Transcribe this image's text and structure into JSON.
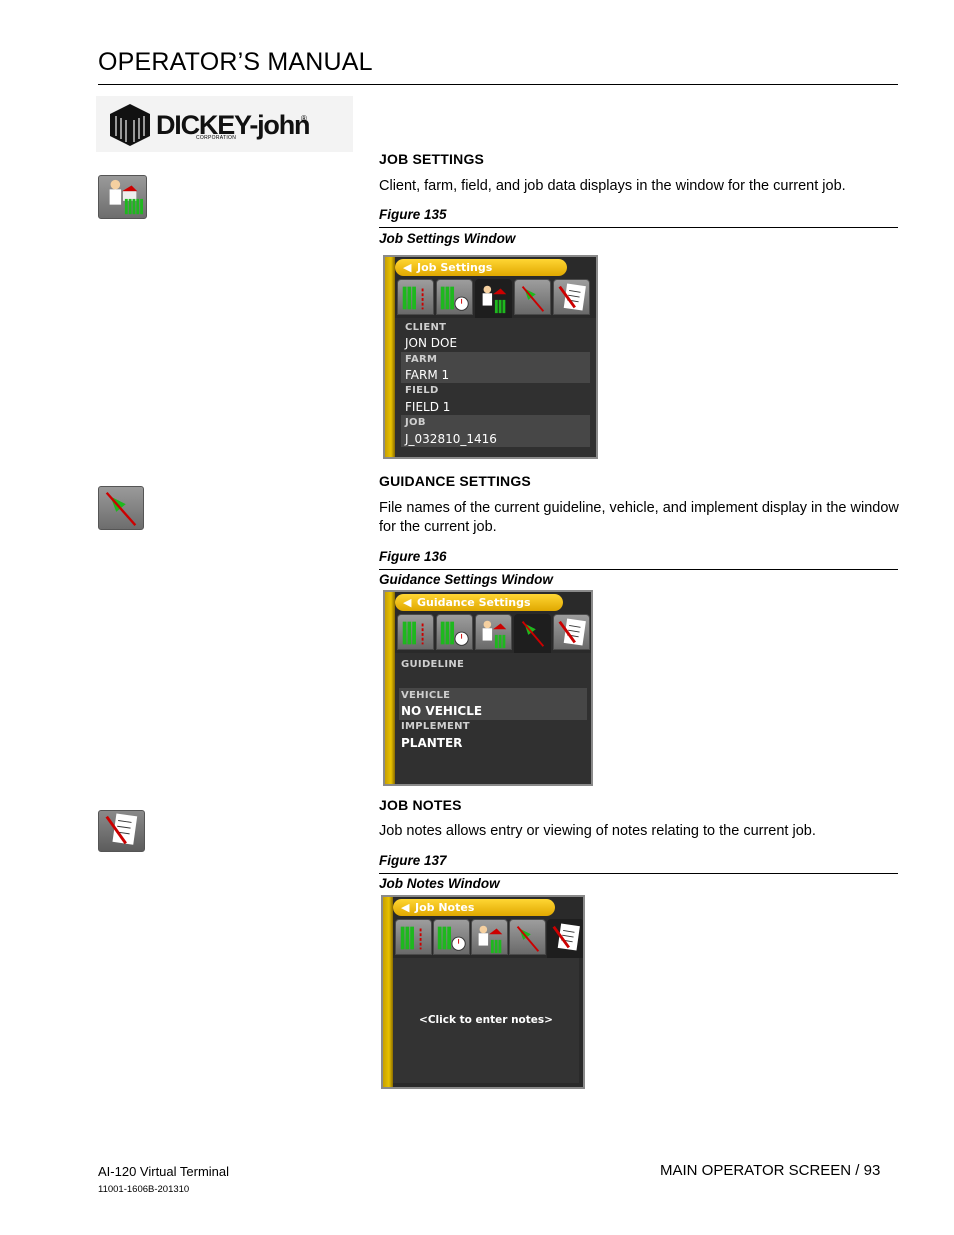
{
  "header": {
    "title": "OPERATOR’S MANUAL"
  },
  "logo": {
    "brand": "DICKEY-john",
    "reg": "®",
    "corp": "CORPORATION"
  },
  "icons": [
    "job-settings-icon",
    "guidance-settings-icon",
    "job-notes-icon"
  ],
  "colors": {
    "accent_yellow": "#f2b400",
    "screen_bg": "#2a2a2a",
    "field_green": "#1eb81e"
  },
  "sections": {
    "job_settings": {
      "heading": "JOB SETTINGS",
      "text": "Client, farm, field, and job data displays in the window for the current job.",
      "figure_no": "Figure 135",
      "figure_title": "Job Settings Window",
      "window": {
        "title": "Job Settings",
        "rows": [
          {
            "label": "CLIENT",
            "value": "JON DOE"
          },
          {
            "label": "FARM",
            "value": "FARM 1"
          },
          {
            "label": "FIELD",
            "value": "FIELD 1"
          },
          {
            "label": "JOB",
            "value": "J_032810_1416"
          }
        ]
      }
    },
    "guidance_settings": {
      "heading": "GUIDANCE SETTINGS",
      "text": "File names of the current guideline, vehicle, and implement display in the window for the current job.",
      "figure_no": "Figure 136",
      "figure_title": "Guidance Settings Window",
      "window": {
        "title": "Guidance Settings",
        "rows": [
          {
            "label": "GUIDELINE",
            "value": ""
          },
          {
            "label": "VEHICLE",
            "value": "NO VEHICLE"
          },
          {
            "label": "IMPLEMENT",
            "value": "PLANTER"
          }
        ]
      }
    },
    "job_notes": {
      "heading": "JOB NOTES",
      "text": "Job notes allows entry or viewing of notes relating to the current job.",
      "figure_no": "Figure 137",
      "figure_title": "Job Notes Window",
      "window": {
        "title": "Job Notes",
        "placeholder": "<Click to enter notes>"
      }
    }
  },
  "footer": {
    "product": "AI-120 Virtual Terminal",
    "doc_no": "11001-1606B-201310",
    "page": "MAIN OPERATOR SCREEN / 93"
  }
}
